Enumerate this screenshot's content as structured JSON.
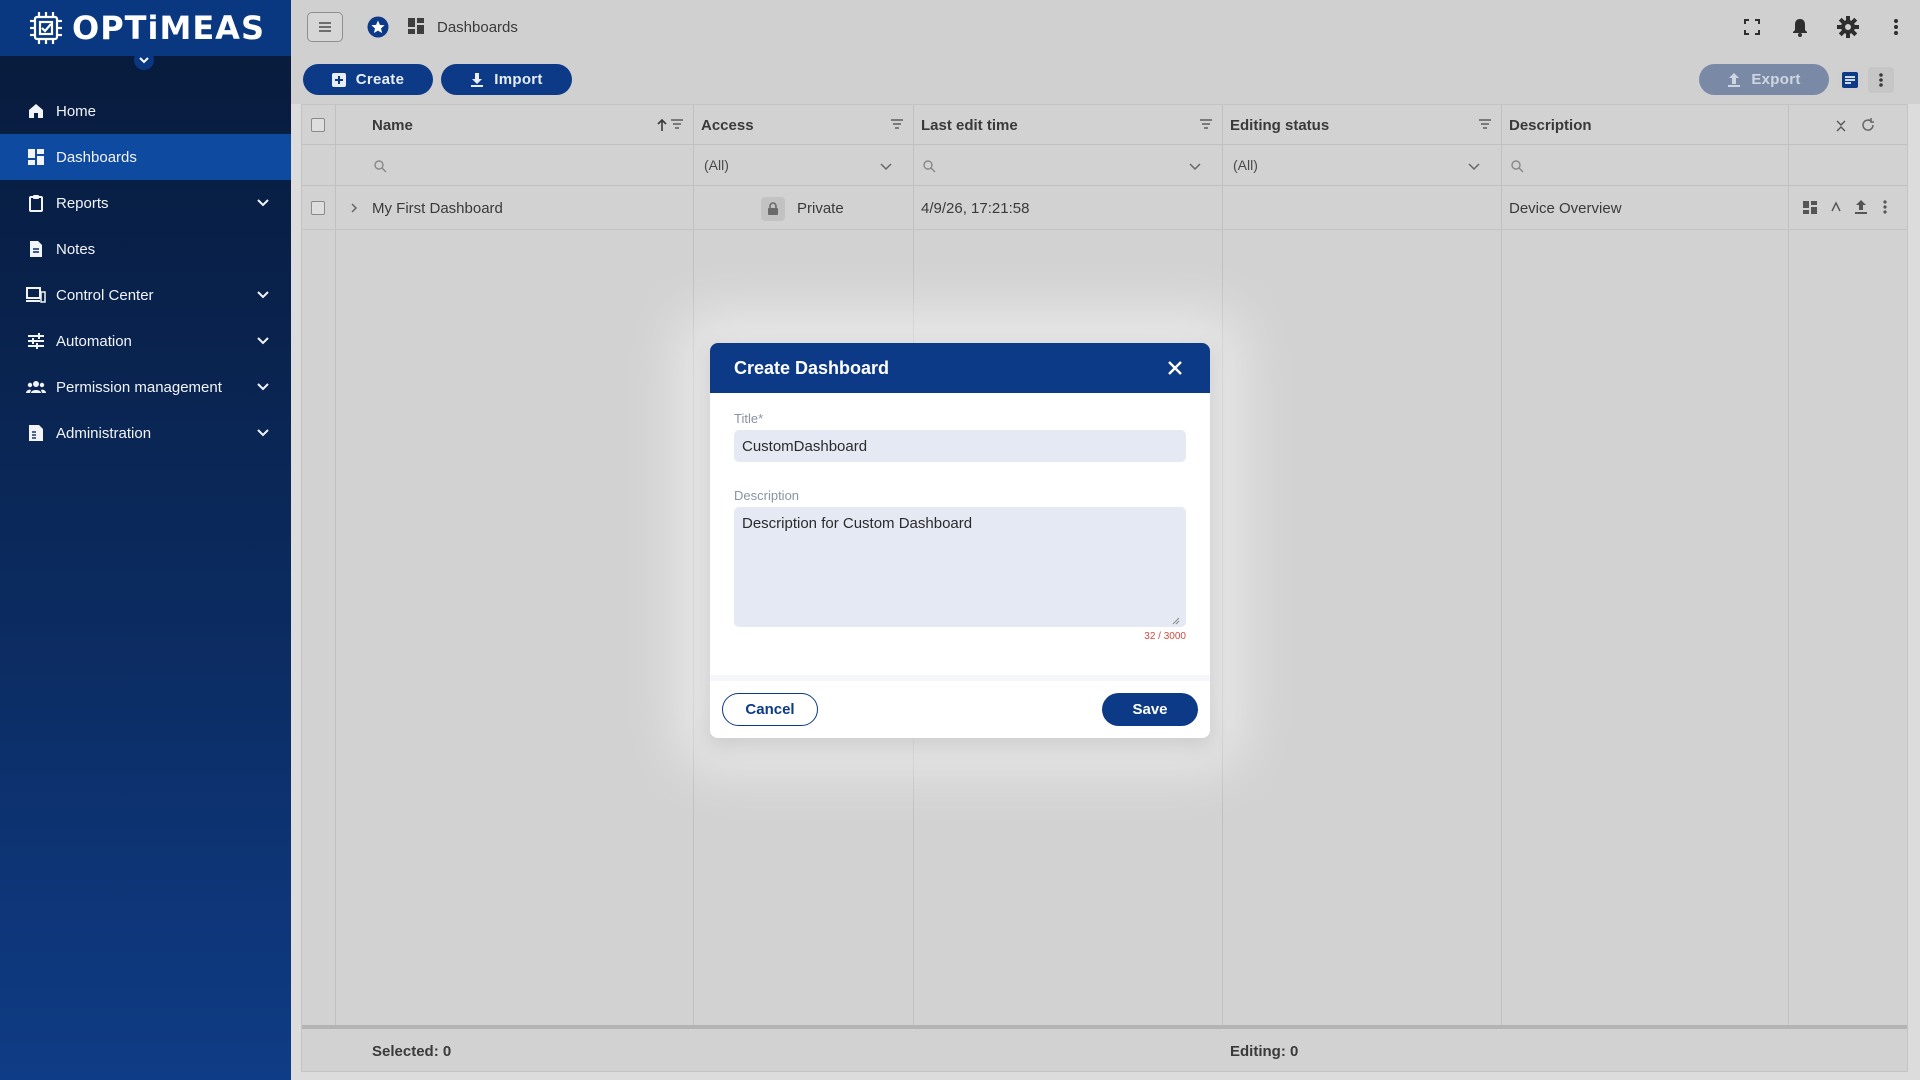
{
  "app": {
    "logo_text": "OPTiMEAS",
    "colors": {
      "brand": "#0d3a86",
      "sidebar_active": "#0f4aa1",
      "counter": "#d24a3b"
    }
  },
  "sidebar": {
    "items": [
      {
        "label": "Home",
        "icon": "home-icon",
        "expandable": false,
        "active": false
      },
      {
        "label": "Dashboards",
        "icon": "dashboard-icon",
        "expandable": false,
        "active": true
      },
      {
        "label": "Reports",
        "icon": "clipboard-icon",
        "expandable": true,
        "active": false
      },
      {
        "label": "Notes",
        "icon": "document-icon",
        "expandable": false,
        "active": false
      },
      {
        "label": "Control Center",
        "icon": "devices-icon",
        "expandable": true,
        "active": false
      },
      {
        "label": "Automation",
        "icon": "sliders-icon",
        "expandable": true,
        "active": false
      },
      {
        "label": "Permission management",
        "icon": "people-icon",
        "expandable": true,
        "active": false
      },
      {
        "label": "Administration",
        "icon": "admin-doc-icon",
        "expandable": true,
        "active": false
      }
    ]
  },
  "topbar": {
    "breadcrumb": "Dashboards",
    "icons": [
      "fullscreen-icon",
      "bell-icon",
      "gear-icon",
      "more-vert-icon"
    ]
  },
  "toolbar": {
    "create_label": "Create",
    "import_label": "Import",
    "export_label": "Export"
  },
  "grid": {
    "columns": [
      {
        "label": "Name"
      },
      {
        "label": "Access"
      },
      {
        "label": "Last edit time"
      },
      {
        "label": "Editing status"
      },
      {
        "label": "Description"
      }
    ],
    "filters": {
      "access": "(All)",
      "editing_status": "(All)"
    },
    "rows": [
      {
        "name": "My First Dashboard",
        "access": "Private",
        "last_edit_time": "4/9/26, 17:21:58",
        "editing_status": "",
        "description": "Device Overview"
      }
    ],
    "footer": {
      "selected": "Selected: 0",
      "editing": "Editing: 0"
    }
  },
  "modal": {
    "title": "Create Dashboard",
    "title_field_label": "Title*",
    "title_value": "CustomDashboard",
    "description_label": "Description",
    "description_value": "Description for Custom Dashboard",
    "counter": "32 / 3000",
    "cancel_label": "Cancel",
    "save_label": "Save"
  }
}
